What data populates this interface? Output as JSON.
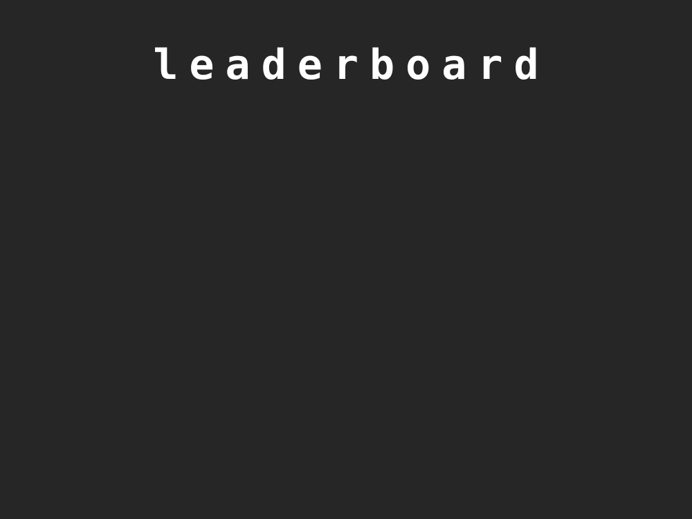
{
  "screen": {
    "title": "leaderboard",
    "background_color": "#262626",
    "text_color": "#ffffff"
  }
}
